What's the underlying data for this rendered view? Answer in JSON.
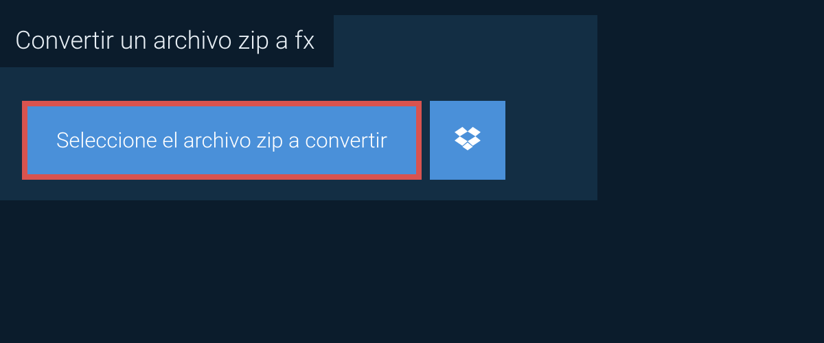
{
  "header": {
    "title": "Convertir un archivo zip a fx"
  },
  "actions": {
    "select_file_label": "Seleccione el archivo zip a convertir"
  },
  "colors": {
    "background": "#0b1c2c",
    "panel": "#132e44",
    "button": "#4a90d9",
    "highlight_border": "#d9534f",
    "text_light": "#e8eff5",
    "text_white": "#ffffff"
  },
  "icons": {
    "dropbox": "dropbox-icon"
  }
}
